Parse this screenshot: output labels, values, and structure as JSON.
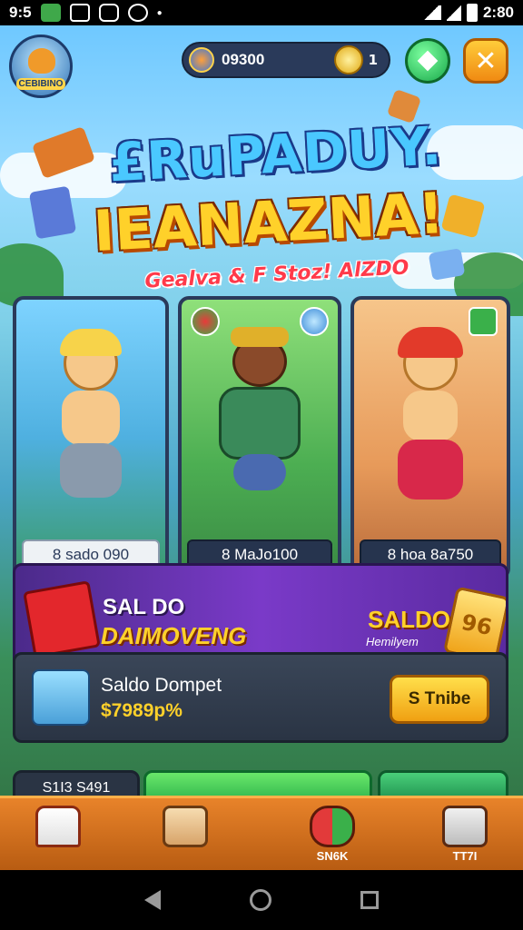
{
  "status_bar": {
    "time_left": "9:5",
    "time_right": "2:80"
  },
  "header": {
    "logo_text": "CEBIBINO",
    "gem_value": "09300",
    "coin_value": "1"
  },
  "title": {
    "line1": "£RuPADUY.",
    "line2": "IEANAZNA!",
    "subtitle": "Gealva & F Stoz! AlZDO"
  },
  "cards": [
    {
      "label": "8 sado 090",
      "icon": "fox-hero"
    },
    {
      "label": "8 MaJo100",
      "icon": "warrior-hero"
    },
    {
      "label": "8 hoa 8a750",
      "icon": "fire-hero"
    }
  ],
  "banner": {
    "left_line1": "SAL DO",
    "left_line2": "DAIMOVENG",
    "right_line1": "SALDO",
    "right_line2": "Hemilyem",
    "ticket_text": "96"
  },
  "wallet": {
    "title": "Saldo Dompet",
    "value": "$7989p%",
    "button_label": "S Tnibe"
  },
  "bottom_tiles": {
    "left_text": "S1I3 S491"
  },
  "nav": {
    "items": [
      {
        "name": "home",
        "label": ""
      },
      {
        "name": "shop",
        "label": ""
      },
      {
        "name": "events",
        "label": "SN6K"
      },
      {
        "name": "tv",
        "label": "TT7I"
      }
    ]
  },
  "colors": {
    "accent_orange": "#e8832a",
    "gold": "#ffd12a",
    "panel": "#2a3444",
    "purple": "#7a3ac8"
  }
}
